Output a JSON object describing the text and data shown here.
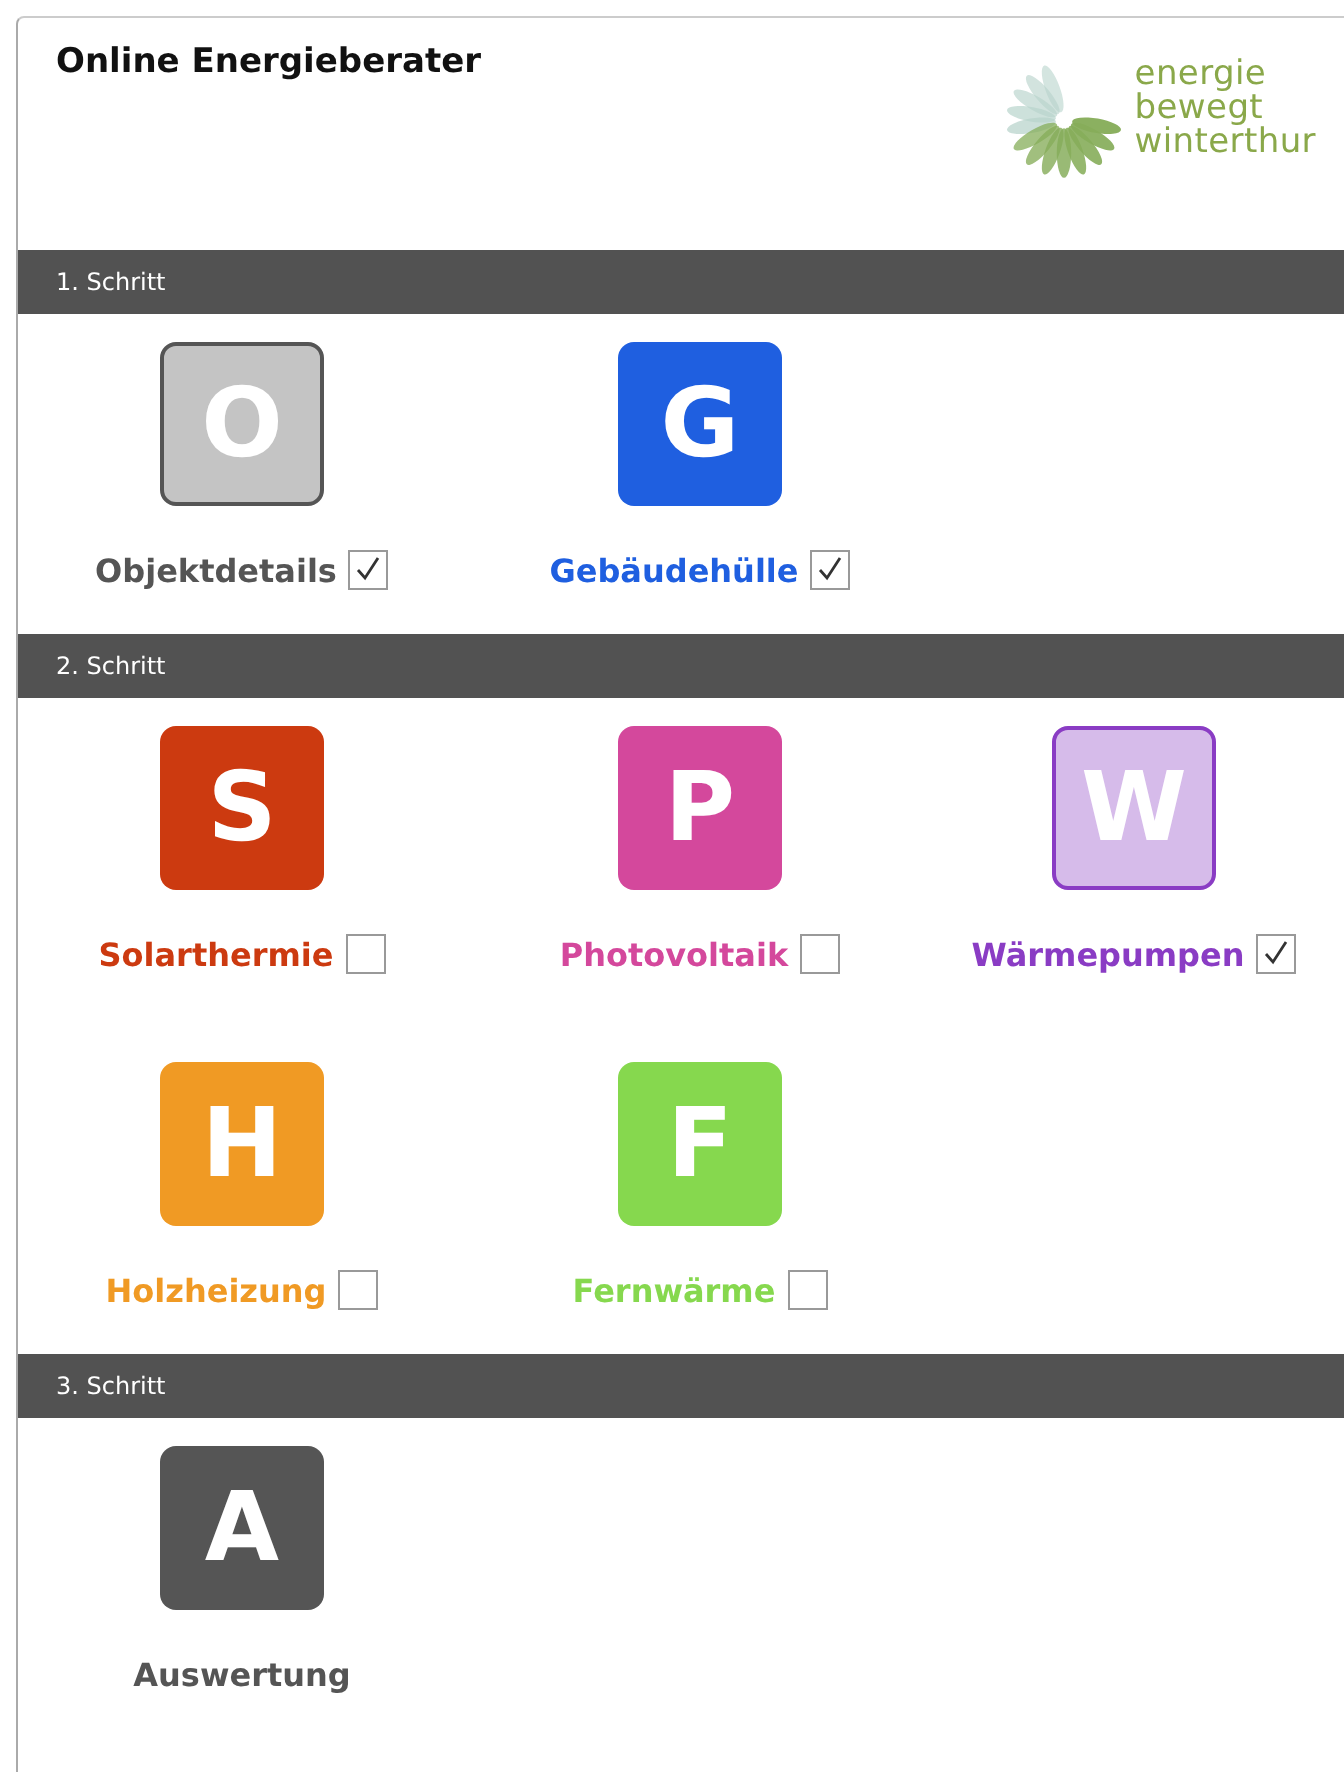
{
  "header": {
    "title": "Online Energieberater",
    "logo_lines": [
      "energie",
      "bewegt",
      "winterthur"
    ]
  },
  "steps": [
    {
      "label": "1. Schritt",
      "rows": [
        [
          {
            "letter": "O",
            "name": "Objektdetails",
            "color": "#555555",
            "outlined": true,
            "kind": "checkbox",
            "checked": true
          },
          {
            "letter": "G",
            "name": "Gebäudehülle",
            "color": "#1f5fe0",
            "outlined": false,
            "kind": "checkbox",
            "checked": true
          }
        ]
      ]
    },
    {
      "label": "2. Schritt",
      "rows": [
        [
          {
            "letter": "S",
            "name": "Solarthermie",
            "color": "#cc3a10",
            "outlined": false,
            "kind": "checkbox",
            "checked": false
          },
          {
            "letter": "P",
            "name": "Photovoltaik",
            "color": "#d4489c",
            "outlined": false,
            "kind": "checkbox",
            "checked": false
          },
          {
            "letter": "W",
            "name": "Wärmepumpen",
            "color": "#8a3cc4",
            "outlined": true,
            "kind": "checkbox",
            "checked": true
          }
        ],
        [
          {
            "letter": "H",
            "name": "Holzheizung",
            "color": "#f09a24",
            "outlined": false,
            "kind": "checkbox",
            "checked": false
          },
          {
            "letter": "F",
            "name": "Fernwärme",
            "color": "#86d84e",
            "outlined": false,
            "kind": "checkbox",
            "checked": false
          }
        ]
      ]
    },
    {
      "label": "3. Schritt",
      "rows": [
        [
          {
            "letter": "A",
            "name": "Auswertung",
            "color": "#555555",
            "outlined": false,
            "kind": "plain"
          }
        ]
      ]
    }
  ]
}
